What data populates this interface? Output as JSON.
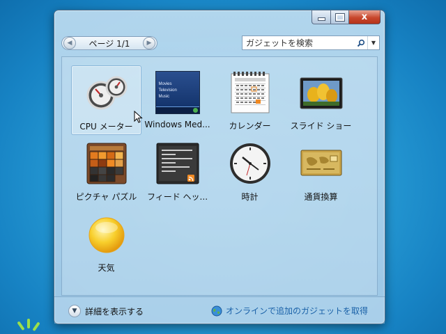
{
  "window": {
    "controls": {
      "close_label": "x"
    }
  },
  "pager": {
    "label": "ページ 1/1",
    "prev": "◀",
    "next": "▶"
  },
  "search": {
    "placeholder": "ガジェットを検索",
    "dropdown": "▼"
  },
  "gadgets": [
    {
      "label": "CPU メーター",
      "icon": "cpu-meter-icon",
      "selected": true
    },
    {
      "label": "Windows Med...",
      "icon": "windows-media-center-icon",
      "selected": false
    },
    {
      "label": "カレンダー",
      "icon": "calendar-icon",
      "selected": false
    },
    {
      "label": "スライド ショー",
      "icon": "slideshow-icon",
      "selected": false
    },
    {
      "label": "ピクチャ パズル",
      "icon": "picture-puzzle-icon",
      "selected": false
    },
    {
      "label": "フィード ヘッ...",
      "icon": "feed-headlines-icon",
      "selected": false
    },
    {
      "label": "時計",
      "icon": "clock-icon",
      "selected": false
    },
    {
      "label": "通貨換算",
      "icon": "currency-icon",
      "selected": false
    },
    {
      "label": "天気",
      "icon": "weather-icon",
      "selected": false
    }
  ],
  "media_center_menu": [
    "Movies",
    "Television",
    "Music"
  ],
  "footer": {
    "details_label": "詳細を表示する",
    "online_label": "オンラインで追加のガジェットを取得"
  },
  "colors": {
    "link": "#1a61a8",
    "close_button": "#c8472c"
  }
}
